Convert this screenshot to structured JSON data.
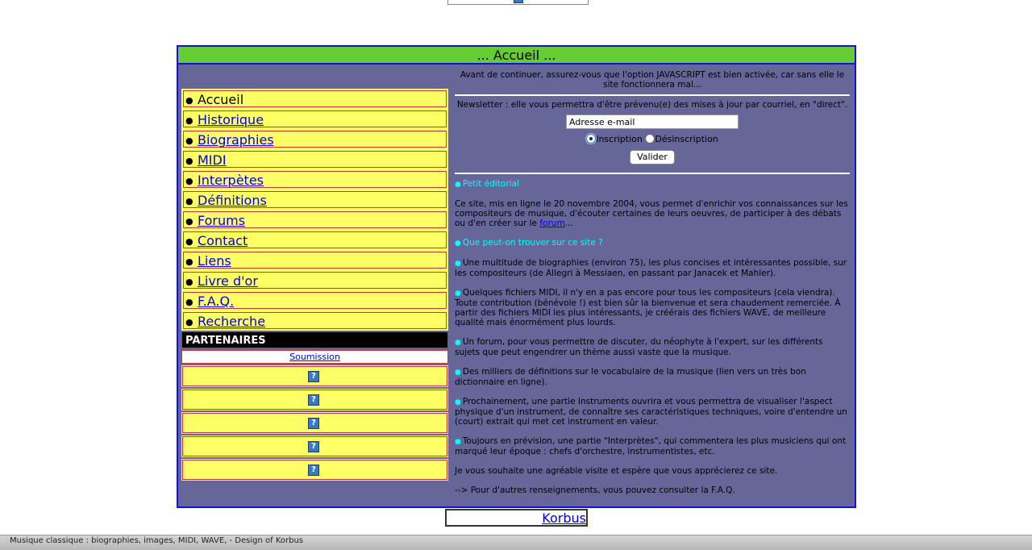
{
  "title": "... Accueil ...",
  "nav": {
    "items": [
      {
        "label": "Accueil",
        "current": true
      },
      {
        "label": "Historique"
      },
      {
        "label": "Biographies"
      },
      {
        "label": "MIDI"
      },
      {
        "label": "Interpètes"
      },
      {
        "label": "Définitions"
      },
      {
        "label": "Forums"
      },
      {
        "label": "Contact"
      },
      {
        "label": "Liens"
      },
      {
        "label": "Livre d'or"
      },
      {
        "label": "F.A.Q."
      },
      {
        "label": "Recherche"
      }
    ],
    "bullet": "●"
  },
  "partners": {
    "header": "PARTENAIRES",
    "submission": "Soumission",
    "slot_icon": "?",
    "slot_count": 5
  },
  "content": {
    "js_warning": "Avant de continuer, assurez-vous que l'option JAVASCRIPT est bien activée, car sans elle le site fonctionnera mal...",
    "newsletter_text": "Newsletter : elle vous permettra d'être prévenu(e) des mises à jour par courriel, en \"direct\".",
    "email_value": "Adresse e-mail",
    "radio_subscribe": "Inscription",
    "radio_unsubscribe": "Désinscription",
    "submit_label": "Valider",
    "editorial_title": "Petit éditorial",
    "intro_before_link": "Ce site, mis en ligne le 20 novembre 2004, vous permet d'enrichir vos connaissances sur les compositeurs de musique, d'écouter certaines de leurs oeuvres, de participer à des débats ou d'en créer sur le ",
    "intro_link": "forum",
    "intro_after_link": "...",
    "what_title": "Que peut-on trouver sur ce site ?",
    "bullets": [
      "Une multitude de biographies (environ 75), les plus concises et intéressantes possible, sur les compositeurs (de Allegri à Messiaen, en passant par Janacek et Mahler).",
      "Quelques fichiers MIDI, il n'y en a pas encore pour tous les compositeurs (cela viendra). Toute contribution (bénévole !) est bien sûr la bienvenue et sera chaudement remerciée. À partir des fichiers MIDI les plus intéressants, je créérais des fichiers WAVE, de meilleure qualité mais énormément plus lourds.",
      "Un forum, pour vous permettre de discuter, du néophyte à l'expert, sur les différents sujets que peut engendrer un thème aussi vaste que la musique.",
      "Des milliers de définitions sur le vocabulaire de la musique (lien vers un très bon dictionnaire en ligne).",
      "Prochainement, une partie Instruments ouvrira et vous permettra de visualiser l'aspect physique d'un instrument, de connaître ses caractéristiques techniques, voire d'entendre un (court) extrait qui met cet instrument en valeur.",
      "Toujours en prévision, une partie \"Interprètes\", qui commentera les plus musiciens qui ont marqué leur époque : chefs d'orchestre, instrumentistes, etc."
    ],
    "closing": "Je vous souhaite une agréable visite et espère que vous apprécierez ce site.",
    "faq_note": "--> Pour d'autres renseignements, vous pouvez consulter la F.A.Q."
  },
  "footer_link": "Korbus",
  "status_bar": "Musique classique : biographies, images, MIDI, WAVE,  - Design of Korbus",
  "colors": {
    "title_bar": "#66cc33",
    "content_bg": "#666699",
    "nav_bg": "#ffff66",
    "accent": "#00ffff",
    "border": "#1010e0"
  }
}
